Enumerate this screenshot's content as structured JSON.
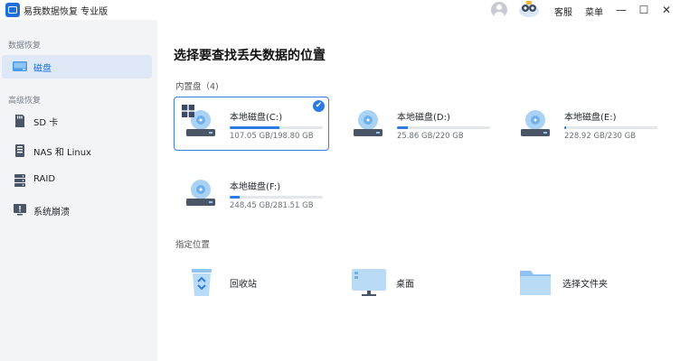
{
  "titlebar": {
    "app_title": "易我数据恢复 专业版",
    "service_label": "客服",
    "menu_label": "菜单",
    "minimize": "—",
    "maximize": "☐",
    "close": "✕"
  },
  "sidebar": {
    "section_data_recovery": "数据恢复",
    "section_advanced": "高级恢复",
    "items": [
      {
        "label": "磁盘",
        "icon": "disk-icon",
        "active": true
      },
      {
        "label": "SD 卡",
        "icon": "sd-card-icon",
        "active": false
      },
      {
        "label": "NAS 和 Linux",
        "icon": "nas-icon",
        "active": false
      },
      {
        "label": "RAID",
        "icon": "raid-icon",
        "active": false
      },
      {
        "label": "系统崩溃",
        "icon": "system-crash-icon",
        "active": false
      }
    ]
  },
  "main": {
    "heading": "选择要查找丢失数据的位置",
    "refresh_icon": "↻",
    "internal_disks_label": "内置盘（4)",
    "drives": [
      {
        "name": "本地磁盘(C:)",
        "size": "107.05 GB/198.80 GB",
        "used_fraction": 0.538,
        "selected": true,
        "system": true
      },
      {
        "name": "本地磁盘(D:)",
        "size": "25.86 GB/220 GB",
        "used_fraction": 0.118,
        "selected": false,
        "system": false
      },
      {
        "name": "本地磁盘(E:)",
        "size": "228.92 GB/230 GB",
        "used_fraction": 0.02,
        "selected": false,
        "system": false
      },
      {
        "name": "本地磁盘(F:)",
        "size": "248.45 GB/281.51 GB",
        "used_fraction": 0.11,
        "selected": false,
        "system": false
      }
    ],
    "specified_location_label": "指定位置",
    "locations": [
      {
        "label": "回收站",
        "icon": "recycle-bin-icon"
      },
      {
        "label": "桌面",
        "icon": "desktop-icon"
      },
      {
        "label": "选择文件夹",
        "icon": "folder-icon"
      }
    ]
  },
  "colors": {
    "accent": "#2b7be0",
    "sidebar_bg": "#f2f4f7",
    "active_item_bg": "#dfe8f6"
  }
}
